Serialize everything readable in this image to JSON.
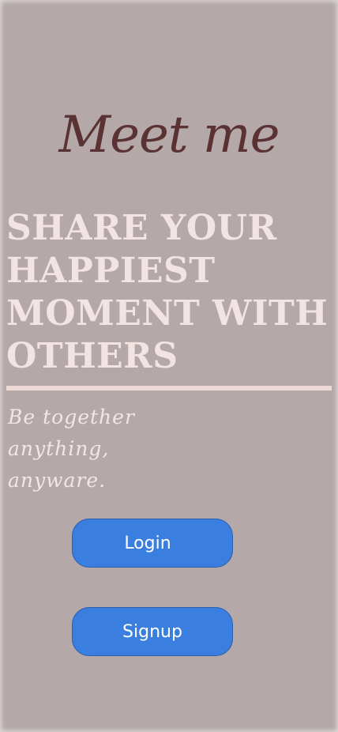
{
  "app": {
    "logo_text": "Meet me"
  },
  "hero": {
    "headline": "Share your happiest moment with others",
    "tagline": "Be together anything, anyware."
  },
  "actions": {
    "login_label": "Login",
    "signup_label": "Signup"
  },
  "colors": {
    "background": "#b4a8a8",
    "logo": "#5a3234",
    "headline": "#f1e4e2",
    "divider": "#efd9d6",
    "button": "#3a7fe0"
  }
}
